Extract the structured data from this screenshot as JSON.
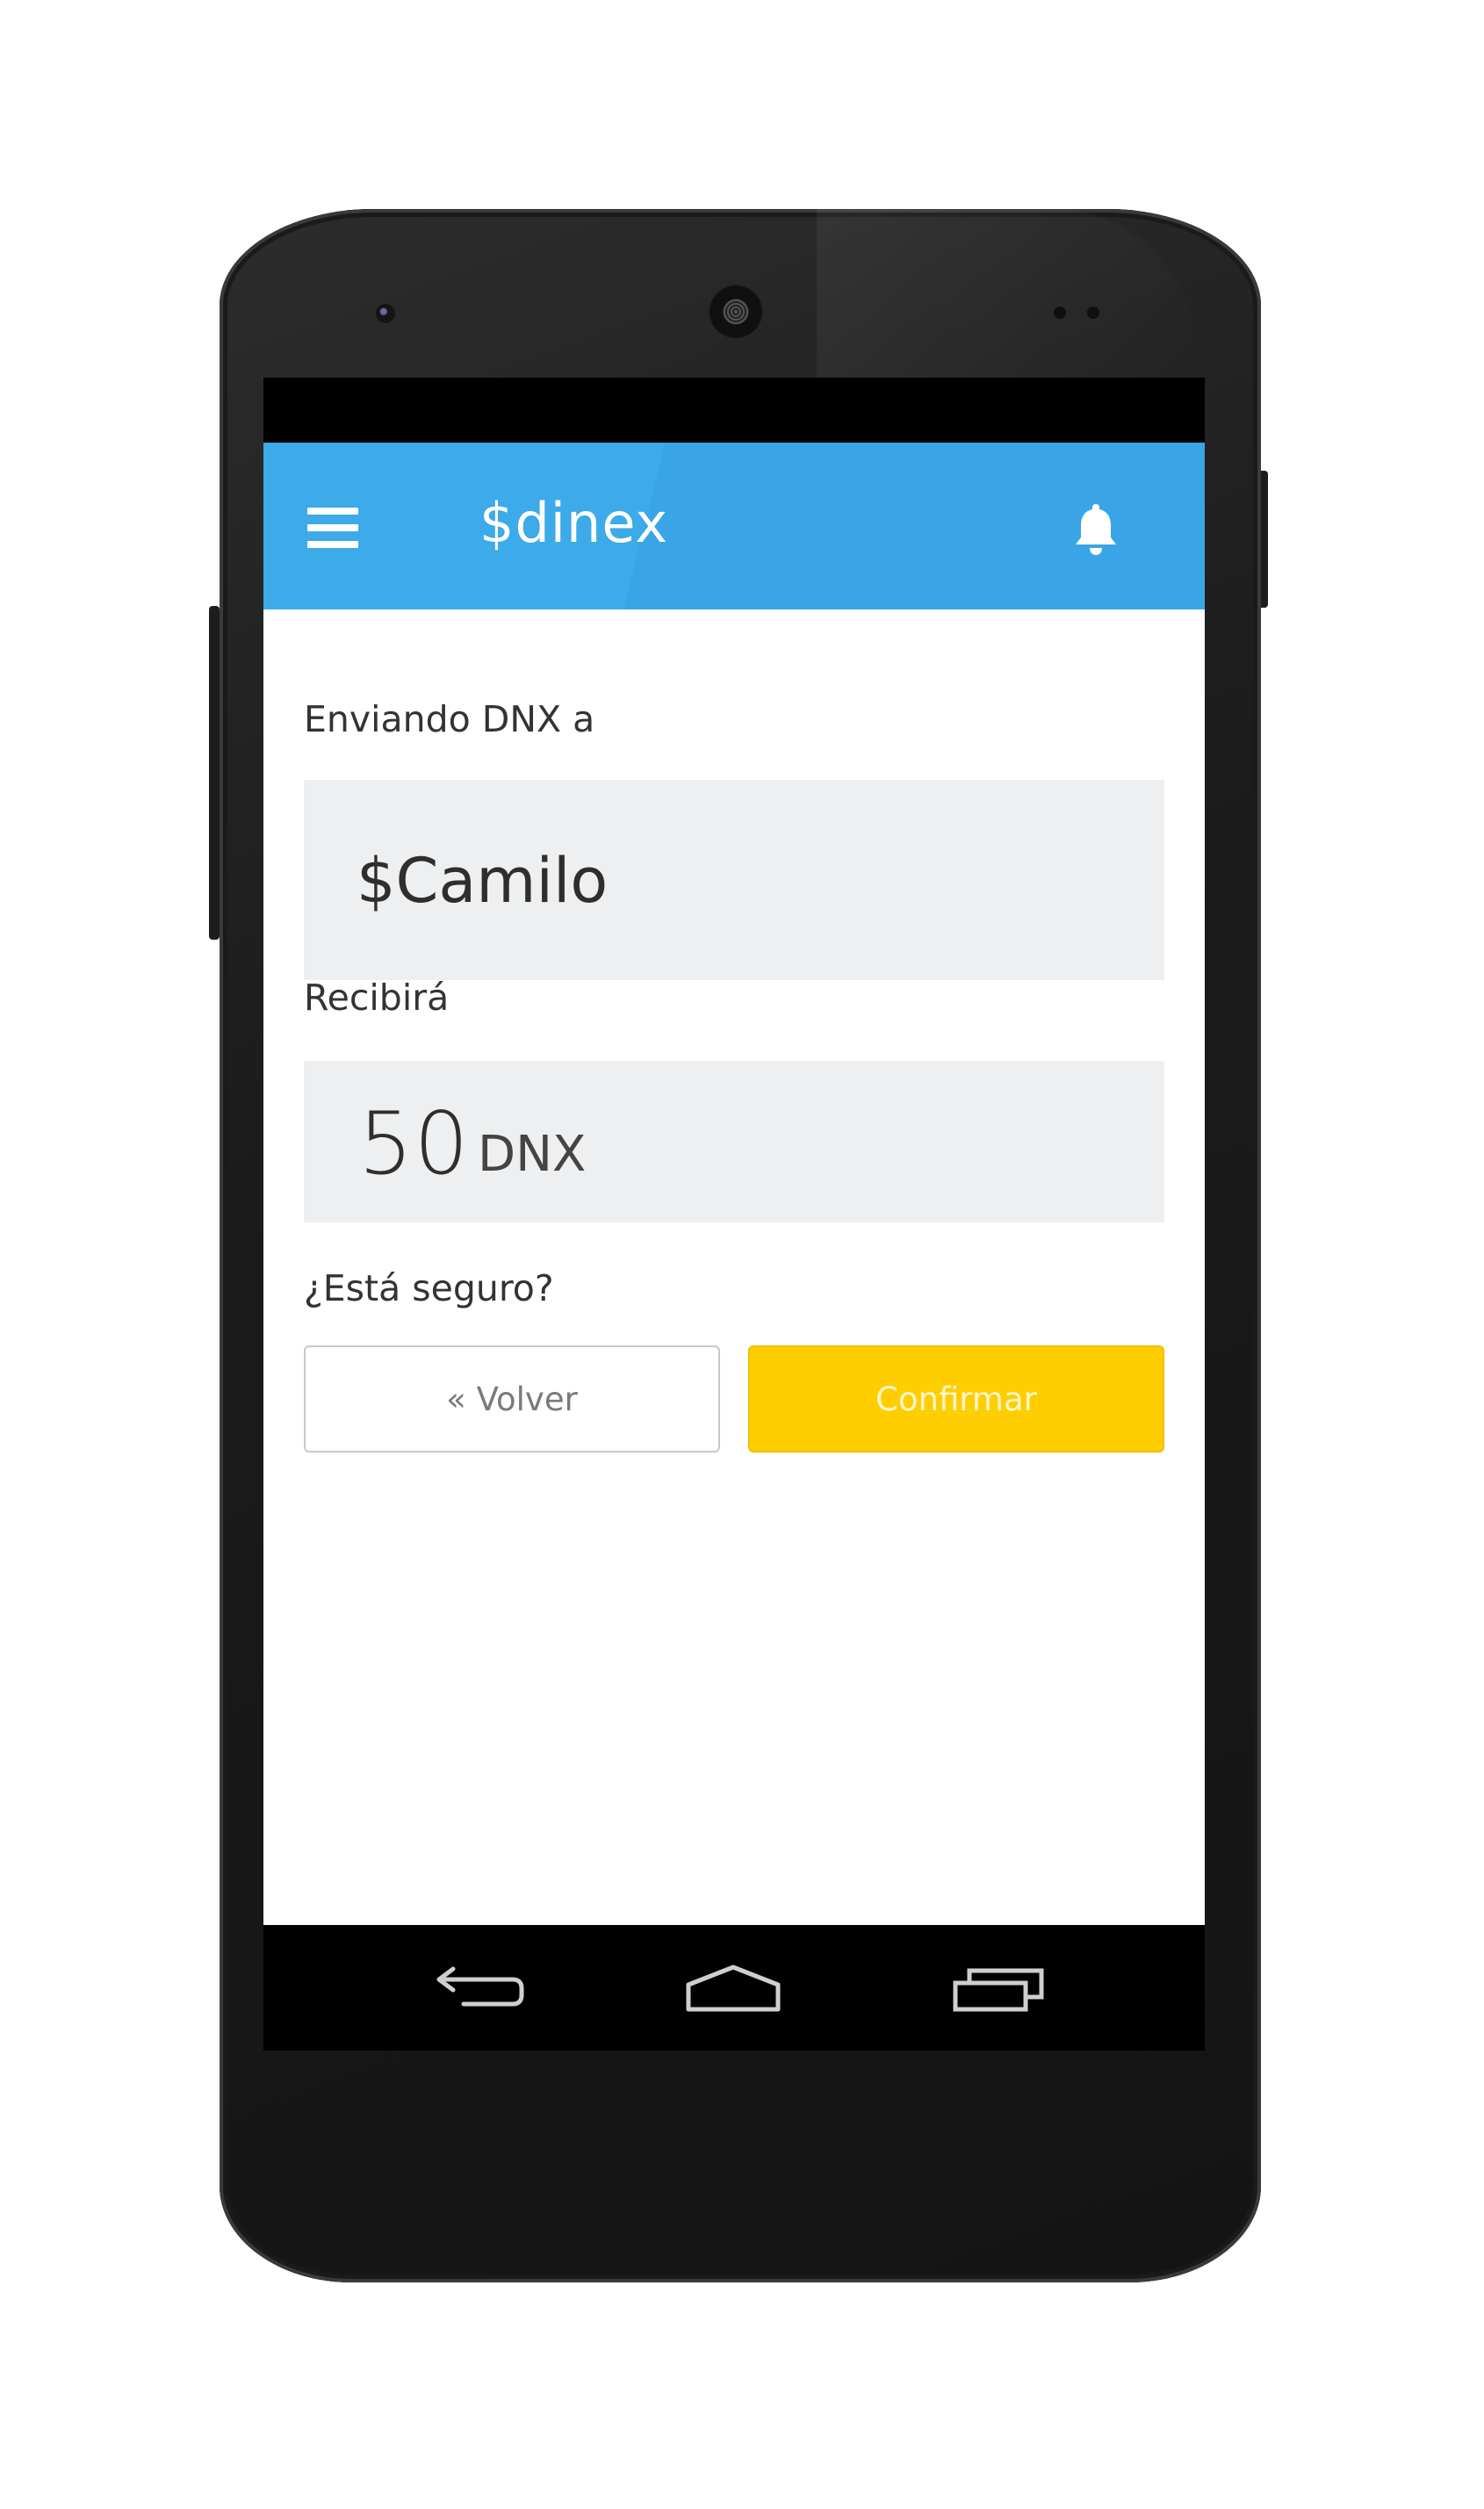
{
  "app": {
    "title": "$dinex"
  },
  "icons": {
    "menu": "hamburger-menu-icon",
    "notifications": "bell-icon",
    "nav_back": "android-back-icon",
    "nav_home": "android-home-icon",
    "nav_recent": "android-recent-apps-icon"
  },
  "send": {
    "sending_label": "Enviando DNX a",
    "recipient": "$Camilo",
    "receive_label": "Recibirá",
    "amount": "50",
    "unit": "DNX",
    "confirm_question": "¿Está seguro?"
  },
  "actions": {
    "back_label": "« Volver",
    "confirm_label": "Confirmar"
  },
  "colors": {
    "app_bar": "#3daae9",
    "confirm_button": "#ffce00",
    "field_background": "#eeeff0"
  }
}
